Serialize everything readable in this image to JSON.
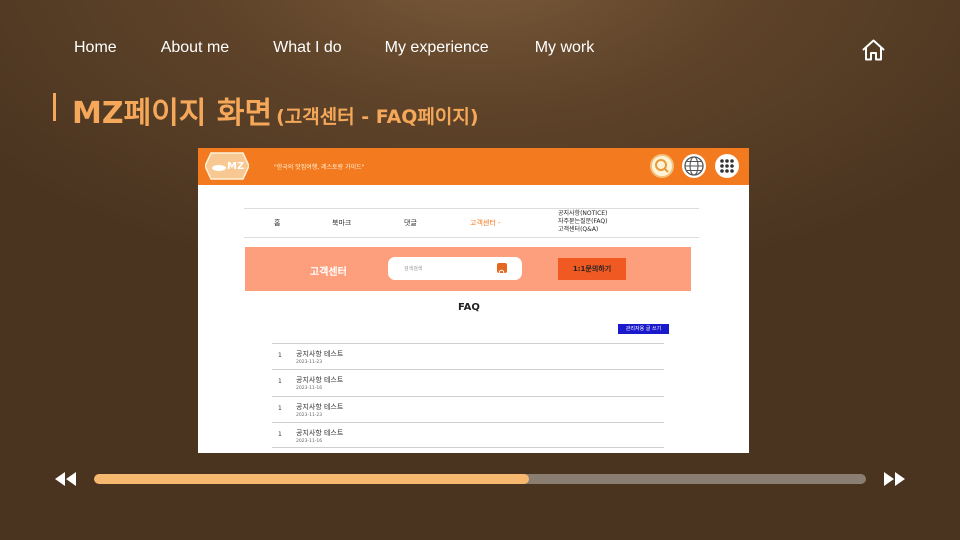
{
  "nav": {
    "items": [
      "Home",
      "About me",
      "What I do",
      "My experience",
      "My work"
    ],
    "home_icon": "home-icon"
  },
  "title": {
    "main": "MZ페이지 화면",
    "sub": "(고객센터 - FAQ페이지)"
  },
  "screenshot": {
    "logo_text": "MZ",
    "slogan": "\"한국의 맛집여행, 레스토랑 가이드\"",
    "header_icons": [
      "search-icon",
      "globe-icon",
      "grid-menu-icon"
    ],
    "subnav": [
      "홈",
      "북마크",
      "댓글",
      "고객센터 -"
    ],
    "subnav_dropdown": [
      "공지사항(NOTICE)",
      "자주묻는질문(FAQ)",
      "고객센터(Q&A)"
    ],
    "cs_title": "고객센터",
    "search_placeholder": "검색검색",
    "ask_button": "1:1문의하기",
    "faq_heading": "FAQ",
    "admin_button": "관리자용 글 쓰기",
    "rows": [
      {
        "num": "1",
        "title": "공지사항 테스트",
        "date": "2023-11-23"
      },
      {
        "num": "1",
        "title": "공지사항 테스트",
        "date": "2023-11-16"
      },
      {
        "num": "1",
        "title": "공지사항 테스트",
        "date": "2023-11-23"
      },
      {
        "num": "1",
        "title": "공지사항 테스트",
        "date": "2023-11-16"
      }
    ],
    "colors": {
      "header": "#f47a20",
      "banner": "#fd9e7c",
      "ask_button": "#f05a22",
      "admin_button": "#1a1acc",
      "active_tab": "#f47a20"
    }
  },
  "player": {
    "progress": 0.563,
    "prev_icon": "rewind-icon",
    "next_icon": "fast-forward-icon",
    "colors": {
      "fill": "#f6b86f",
      "track": "#8a7e72"
    }
  },
  "colors": {
    "accent": "#f6a85a",
    "background": "#4a3420"
  }
}
